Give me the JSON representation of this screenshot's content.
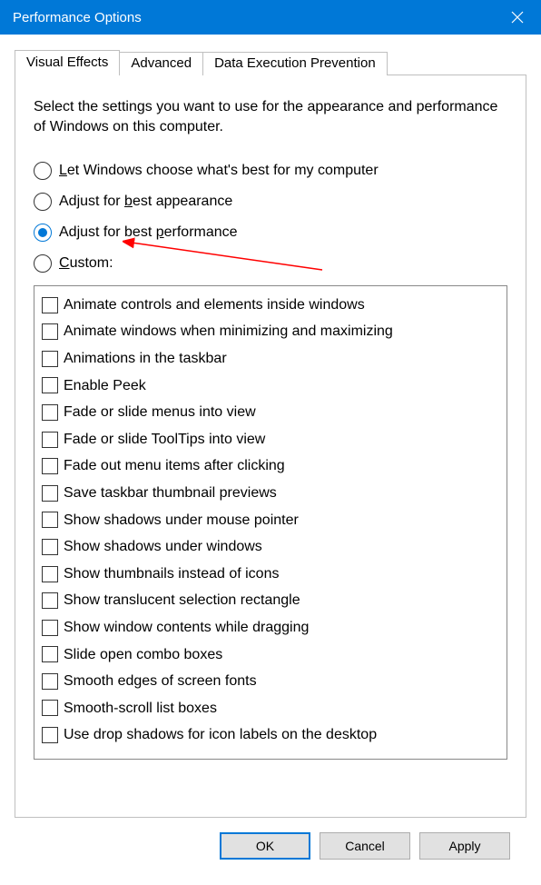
{
  "window": {
    "title": "Performance Options"
  },
  "tabs": [
    {
      "label": "Visual Effects",
      "active": true
    },
    {
      "label": "Advanced",
      "active": false
    },
    {
      "label": "Data Execution Prevention",
      "active": false
    }
  ],
  "intro": "Select the settings you want to use for the appearance and performance of Windows on this computer.",
  "radios": {
    "let_windows_pre": "",
    "let_windows_u": "L",
    "let_windows_post": "et Windows choose what's best for my computer",
    "best_appearance_pre": "Adjust for ",
    "best_appearance_u": "b",
    "best_appearance_post": "est appearance",
    "best_performance_pre": "Adjust for best ",
    "best_performance_u": "p",
    "best_performance_post": "erformance",
    "custom_pre": "",
    "custom_u": "C",
    "custom_post": "ustom:"
  },
  "checklist": [
    "Animate controls and elements inside windows",
    "Animate windows when minimizing and maximizing",
    "Animations in the taskbar",
    "Enable Peek",
    "Fade or slide menus into view",
    "Fade or slide ToolTips into view",
    "Fade out menu items after clicking",
    "Save taskbar thumbnail previews",
    "Show shadows under mouse pointer",
    "Show shadows under windows",
    "Show thumbnails instead of icons",
    "Show translucent selection rectangle",
    "Show window contents while dragging",
    "Slide open combo boxes",
    "Smooth edges of screen fonts",
    "Smooth-scroll list boxes",
    "Use drop shadows for icon labels on the desktop"
  ],
  "buttons": {
    "ok": "OK",
    "cancel": "Cancel",
    "apply": "Apply"
  }
}
